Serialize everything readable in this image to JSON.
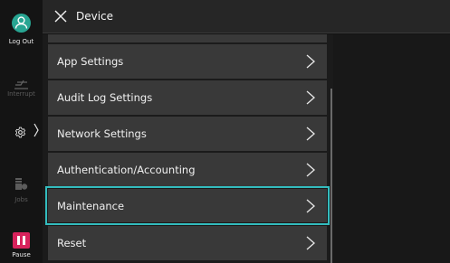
{
  "header": {
    "title": "Device"
  },
  "rail": {
    "logout_label": "Log Out",
    "interrupt_label": "Interrupt",
    "jobs_label": "Jobs",
    "pause_label": "Pause"
  },
  "menu": {
    "items": [
      {
        "label": ""
      },
      {
        "label": "App Settings"
      },
      {
        "label": "Audit Log Settings"
      },
      {
        "label": "Network Settings"
      },
      {
        "label": "Authentication/Accounting"
      },
      {
        "label": "Maintenance"
      },
      {
        "label": "Reset"
      }
    ],
    "selected": "Maintenance"
  },
  "colors": {
    "accent_selection": "#33bcbe",
    "logout": "#27a592",
    "pause": "#d8225c"
  }
}
